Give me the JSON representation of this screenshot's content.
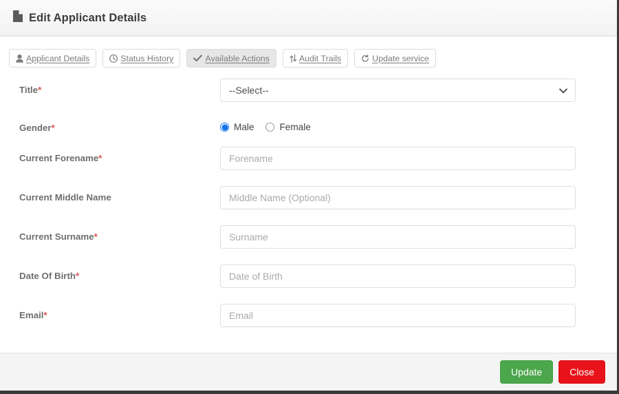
{
  "header": {
    "title": "Edit Applicant Details",
    "icon": "file-document-icon"
  },
  "tabs": [
    {
      "label": "Applicant Details",
      "icon": "user-icon",
      "active": false
    },
    {
      "label": "Status History",
      "icon": "clock-icon",
      "active": false
    },
    {
      "label": "Available Actions",
      "icon": "check-icon",
      "active": true
    },
    {
      "label": "Audit Trails",
      "icon": "exchange-icon",
      "active": false
    },
    {
      "label": "Update service",
      "icon": "refresh-icon",
      "active": false
    }
  ],
  "form": {
    "title": {
      "label": "Title",
      "required": "*",
      "selected": "--Select--"
    },
    "gender": {
      "label": "Gender",
      "required": "*",
      "options": [
        {
          "label": "Male",
          "checked": true
        },
        {
          "label": "Female",
          "checked": false
        }
      ]
    },
    "forename": {
      "label": "Current Forename",
      "required": "*",
      "placeholder": "Forename",
      "value": ""
    },
    "middlename": {
      "label": "Current Middle Name",
      "required": "",
      "placeholder": "Middle Name (Optional)",
      "value": ""
    },
    "surname": {
      "label": "Current Surname",
      "required": "*",
      "placeholder": "Surname",
      "value": ""
    },
    "dob": {
      "label": "Date Of Birth",
      "required": "*",
      "placeholder": "Date of Birth",
      "value": ""
    },
    "email": {
      "label": "Email",
      "required": "*",
      "placeholder": "Email",
      "value": ""
    }
  },
  "footer": {
    "update_label": "Update",
    "close_label": "Close"
  },
  "colors": {
    "update_green": "#4ca64c",
    "close_red": "#e8131a",
    "required_red": "#d9534f",
    "radio_blue": "#1473e6",
    "active_tab_bg": "#e7e7e7"
  }
}
